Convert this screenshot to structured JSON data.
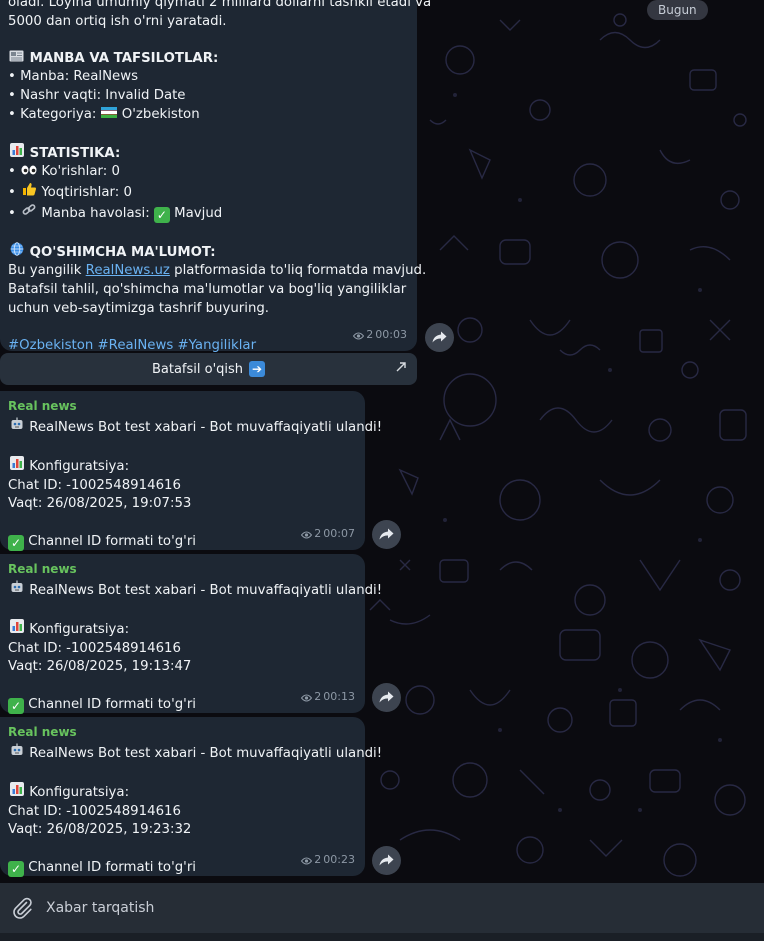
{
  "date_pill": "Bugun",
  "message1": {
    "lines_top": [
      "oladi. Loyiha umumiy qiymati 2 milliard dollarni tashkil etadi va",
      "5000 dan ortiq ish o'rni yaratadi."
    ],
    "section1_icon": "newspaper-icon",
    "section1_title": "MANBA VA TAFSILOTLAR:",
    "source_line": "• Manba: RealNews",
    "published_line": "• Nashr vaqti: Invalid Date",
    "category_prefix": "• Kategoriya: ",
    "category_flag": "uz-flag-icon",
    "category_name": " O'zbekiston",
    "section2_icon": "bar-chart-icon",
    "section2_title": "STATISTIKA:",
    "views_prefix": "• ",
    "views_label": " Ko'rishlar: 0",
    "likes_prefix": "• ",
    "likes_label": " Yoqtirishlar: 0",
    "link_prefix": "• ",
    "link_label": " Manba havolasi: ",
    "link_status": " Mavjud",
    "section3_icon": "globe-icon",
    "section3_title": "QO'SHIMCHA MA'LUMOT:",
    "para_before_link": "Bu yangilik ",
    "para_link": "RealNews.uz",
    "para_after_link": " platformasida to'liq formatda mavjud.",
    "para_line2": "Batafsil tahlil, qo'shimcha ma'lumotlar va bog'liq yangiliklar",
    "para_line3": "uchun veb-saytimizga tashrif buyuring.",
    "hashtags": "#Ozbekiston #RealNews #Yangiliklar",
    "views": "2",
    "time": "00:03",
    "button_label": "Batafsil o'qish"
  },
  "bot_messages": [
    {
      "sender": "Real news",
      "title": "RealNews Bot test xabari - Bot muvaffaqiyatli ulandi!",
      "config_label": "Konfiguratsiya:",
      "chat_id": "Chat ID: -1002548914616",
      "time_line": "Vaqt: 26/08/2025, 19:07:53",
      "status": "Channel ID formati to'g'ri",
      "views": "2",
      "time": "00:07"
    },
    {
      "sender": "Real news",
      "title": "RealNews Bot test xabari - Bot muvaffaqiyatli ulandi!",
      "config_label": "Konfiguratsiya:",
      "chat_id": "Chat ID: -1002548914616",
      "time_line": "Vaqt: 26/08/2025, 19:13:47",
      "status": "Channel ID formati to'g'ri",
      "views": "2",
      "time": "00:13"
    },
    {
      "sender": "Real news",
      "title": "RealNews Bot test xabari - Bot muvaffaqiyatli ulandi!",
      "config_label": "Konfiguratsiya:",
      "chat_id": "Chat ID: -1002548914616",
      "time_line": "Vaqt: 26/08/2025, 19:23:32",
      "status": "Channel ID formati to'g'ri",
      "views": "2",
      "time": "00:23"
    }
  ],
  "composer": {
    "placeholder": "Xabar tarqatish",
    "attach_icon": "paperclip-icon"
  },
  "colors": {
    "bubble": "#1e2733",
    "link": "#6ab2f2",
    "sender": "#68c35e",
    "chat_background": "#0b0b10"
  }
}
